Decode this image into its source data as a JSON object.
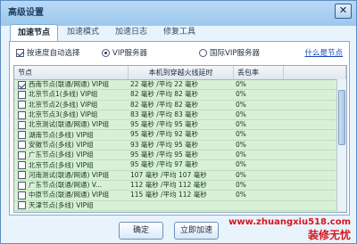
{
  "window": {
    "title": "高级设置",
    "close_label": "✕"
  },
  "tabs": [
    {
      "label": "加速节点",
      "active": true
    },
    {
      "label": "加速模式",
      "active": false
    },
    {
      "label": "加速日志",
      "active": false
    },
    {
      "label": "修复工具",
      "active": false
    }
  ],
  "options": {
    "auto_select_label": "按速度自动选择",
    "vip_server_label": "VIP服务器",
    "intl_vip_label": "国际VIP服务器",
    "what_is_node_link": "什么是节点"
  },
  "table": {
    "columns": [
      "节点",
      "本机到穿越火线延时",
      "丢包率"
    ],
    "rows": [
      {
        "node": "西南节点(联通/网通) VIP组",
        "latency": "22 毫秒 /平均 22 毫秒",
        "loss": "0%",
        "checked": true
      },
      {
        "node": "北京节点1(多线) VIP组",
        "latency": "82 毫秒 /平均 82 毫秒",
        "loss": "0%",
        "checked": false
      },
      {
        "node": "北京节点2(多线) VIP组",
        "latency": "82 毫秒 /平均 82 毫秒",
        "loss": "0%",
        "checked": false
      },
      {
        "node": "北京节点3(多线) VIP组",
        "latency": "83 毫秒 /平均 83 毫秒",
        "loss": "0%",
        "checked": false
      },
      {
        "node": "北京测试(联通/网通) VIP组",
        "latency": "95 毫秒 /平均 95 毫秒",
        "loss": "0%",
        "checked": false
      },
      {
        "node": "湖南节点(多线) VIP组",
        "latency": "95 毫秒 /平均 92 毫秒",
        "loss": "0%",
        "checked": false
      },
      {
        "node": "安徽节点(多线) VIP组",
        "latency": "93 毫秒 /平均 95 毫秒",
        "loss": "0%",
        "checked": false
      },
      {
        "node": "广东节点(多线) VIP组",
        "latency": "95 毫秒 /平均 95 毫秒",
        "loss": "0%",
        "checked": false
      },
      {
        "node": "北京节点(多线) VIP组",
        "latency": "95 毫秒 /平均 97 毫秒",
        "loss": "0%",
        "checked": false
      },
      {
        "node": "河南测试(联通/网通) VIP组",
        "latency": "107 毫秒 /平均 107 毫秒",
        "loss": "0%",
        "checked": false
      },
      {
        "node": "广东节点(联通/网通) V...",
        "latency": "112 毫秒 /平均 112 毫秒",
        "loss": "0%",
        "checked": false
      },
      {
        "node": "中原节点(联通/网通) VIP组",
        "latency": "115 毫秒 /平均 112 毫秒",
        "loss": "0%",
        "checked": false
      },
      {
        "node": "天津节点(多线) VIP组",
        "latency": "",
        "loss": "",
        "checked": false
      }
    ]
  },
  "buttons": {
    "confirm": "确定",
    "accelerate_now": "立即加速"
  },
  "watermark": {
    "url": "www.zhuangxiu518.com",
    "text": "装修无忧"
  }
}
